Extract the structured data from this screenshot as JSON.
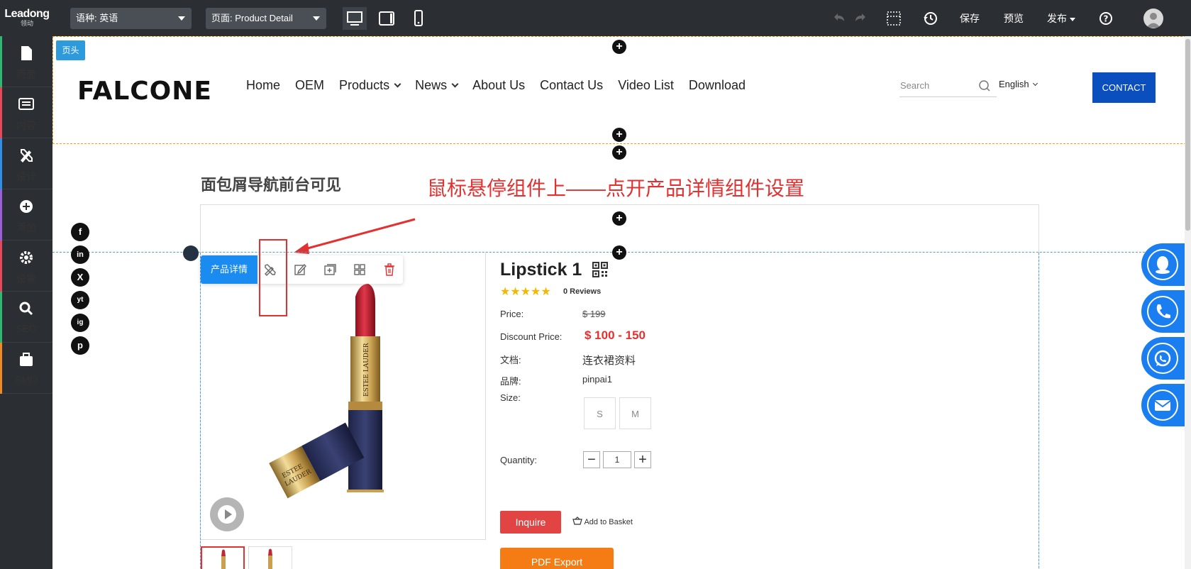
{
  "topbar": {
    "logo_en": "Leadong",
    "logo_cn": "领动",
    "language_select": "语种:  英语",
    "page_select": "页面:  Product Detail",
    "save": "保存",
    "preview": "预览",
    "publish": "发布"
  },
  "sidebar": {
    "items": [
      {
        "label": "页面",
        "color": "#2eb872"
      },
      {
        "label": "内容",
        "color": "#e8475a"
      },
      {
        "label": "设计",
        "color": "#2e8fe8"
      },
      {
        "label": "添加",
        "color": "#9a5ed8"
      },
      {
        "label": "设置",
        "color": "#e8475a"
      },
      {
        "label": "SEO",
        "color": "#2eb872"
      },
      {
        "label": "SMO",
        "color": "#f08a24"
      }
    ]
  },
  "site_header": {
    "tag": "页头",
    "brand": "FALCONE",
    "nav": [
      "Home",
      "OEM",
      "Products",
      "News",
      "About Us",
      "Contact Us",
      "Video List",
      "Download"
    ],
    "search_placeholder": "Search",
    "language": "English",
    "contact_button": "CONTACT"
  },
  "page": {
    "breadcrumb_note": "面包屑导航前台可见",
    "annotation": "鼠标悬停组件上——点开产品详情组件设置",
    "component_tag": "产品详情"
  },
  "social": [
    "f",
    "in",
    "X",
    "yt",
    "ig",
    "p"
  ],
  "product": {
    "title": "Lipstick 1",
    "rating": 5,
    "reviews": "0 Reviews",
    "price_label": "Price:",
    "price_value": "$ 199",
    "discount_label": "Discount Price:",
    "discount_value": "$ 100  -  150",
    "doc_label": "文档:",
    "doc_value": "连衣裙资料",
    "brand_label": "品牌:",
    "brand_value": "pinpai1",
    "size_label": "Size:",
    "sizes": [
      "S",
      "M"
    ],
    "quantity_label": "Quantity:",
    "quantity": "1",
    "inquire": "Inquire",
    "add_to_basket": "Add to Basket",
    "pdf_export": "PDF Export"
  },
  "colors": {
    "accent_blue": "#1a8bf0",
    "contact_blue": "#0b4fbf",
    "annotation_red": "#e23131",
    "pdf_orange": "#f57c14",
    "inquire_red": "#e24444"
  }
}
